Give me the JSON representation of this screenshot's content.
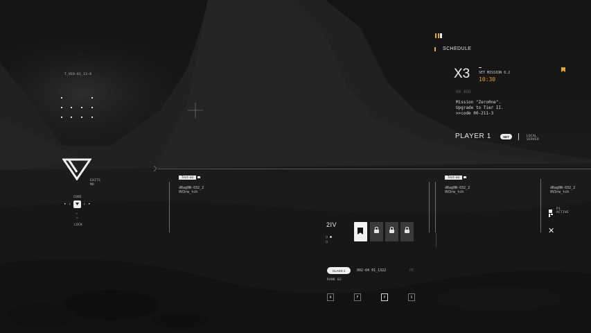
{
  "colors": {
    "accent": "#e3a72a",
    "text": "#d8d8d8"
  },
  "left": {
    "code_label": "T_VEO-01_13-8",
    "icons": [
      "triangle-logo-icon",
      "menu-box-icon"
    ],
    "logo_side": [
      "EXITS",
      "MO"
    ],
    "selector_labels": [
      "CODE",
      "LOCK"
    ]
  },
  "header": {
    "schedule": "SCHEDULE",
    "multiplier": "X3",
    "mission": "SET MISSION 0.2",
    "time": "10:30",
    "days": "08 AGO",
    "message_lines": [
      "Mission \"Zero0ne\".",
      "Upgrade to Tier II.",
      ">>code 00-211-3"
    ],
    "player": "PLAYER 1",
    "set_label": "SET",
    "server": [
      "LOCAL",
      "SERVER"
    ]
  },
  "panels": {
    "tag": "Text-ed",
    "data_lines": [
      "dRag0N-032_2",
      "0V3rw_tch"
    ]
  },
  "center": {
    "rank_label": "2IV",
    "tiles": [
      {
        "state": "active",
        "icon": "bookmark-icon"
      },
      {
        "state": "locked",
        "icon": "lock-icon"
      },
      {
        "state": "locked",
        "icon": "lock-icon"
      },
      {
        "state": "locked",
        "icon": "lock-icon"
      }
    ],
    "class_label": "CLASS 1",
    "class_code": "002-04 01_1322",
    "class_tail": "PE",
    "rank_text": "RANK 02",
    "keys": [
      "A",
      "F",
      "P",
      "S"
    ]
  },
  "right_edge": {
    "data_lines": [
      "dRag0N-032_2",
      "0V3rw_tch"
    ],
    "p_label": "P1",
    "p_sub": "ACTIVE"
  }
}
